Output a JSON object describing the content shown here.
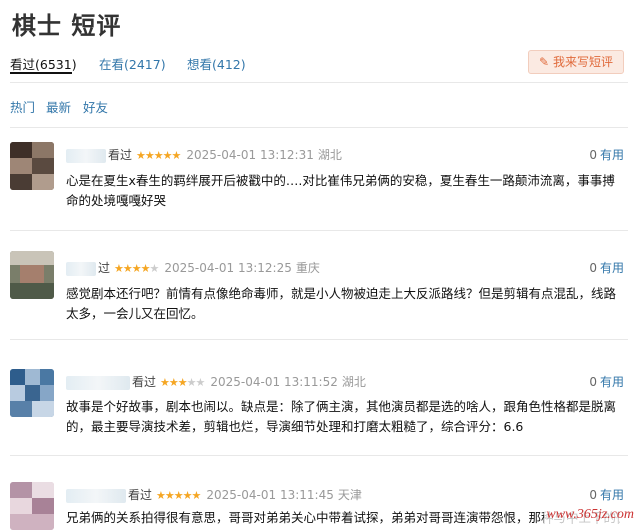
{
  "header": {
    "title": "棋士 短评"
  },
  "tabs": [
    {
      "label": "看过(6531)"
    },
    {
      "label": "在看(2417)"
    },
    {
      "label": "想看(412)"
    }
  ],
  "write_button": {
    "label": "我来写短评",
    "icon": "pencil-icon"
  },
  "sort": [
    {
      "label": "热门"
    },
    {
      "label": "最新"
    },
    {
      "label": "好友"
    }
  ],
  "reviews": [
    {
      "status": "看过",
      "stars": 5,
      "date": "2025-04-01 13:12:31",
      "location": "湖北",
      "useful_count": "0",
      "useful_label": "有用",
      "text": "心是在夏生x春生的羁绊展开后被戳中的….对比崔伟兄弟俩的安稳，夏生春生一路颠沛流离，事事搏命的处境嘎嘎好哭"
    },
    {
      "status": "过",
      "stars": 4,
      "date": "2025-04-01 13:12:25",
      "location": "重庆",
      "useful_count": "0",
      "useful_label": "有用",
      "text": "感觉剧本还行吧？前情有点像绝命毒师，就是小人物被迫走上大反派路线？但是剪辑有点混乱，线路太多，一会儿又在回忆。"
    },
    {
      "status": "看过",
      "stars": 3,
      "date": "2025-04-01 13:11:52",
      "location": "湖北",
      "useful_count": "0",
      "useful_label": "有用",
      "text": "故事是个好故事，剧本也闹以。缺点是：除了俩主演，其他演员都是选的啥人，跟角色性格都是脱离的，最主要导演技术差，剪辑也烂，导演细节处理和打磨太粗糙了，综合评分：6.6"
    },
    {
      "status": "看过",
      "stars": 5,
      "date": "2025-04-01 13:11:45",
      "location": "天津",
      "useful_count": "0",
      "useful_label": "有用",
      "text": "兄弟俩的关系拍得很有意思，哥哥对弟弟关心中带着试探，弟弟对哥哥连演带怨恨，那种与中上下的微妙妙"
    }
  ],
  "watermark": "www.365jz.com"
}
